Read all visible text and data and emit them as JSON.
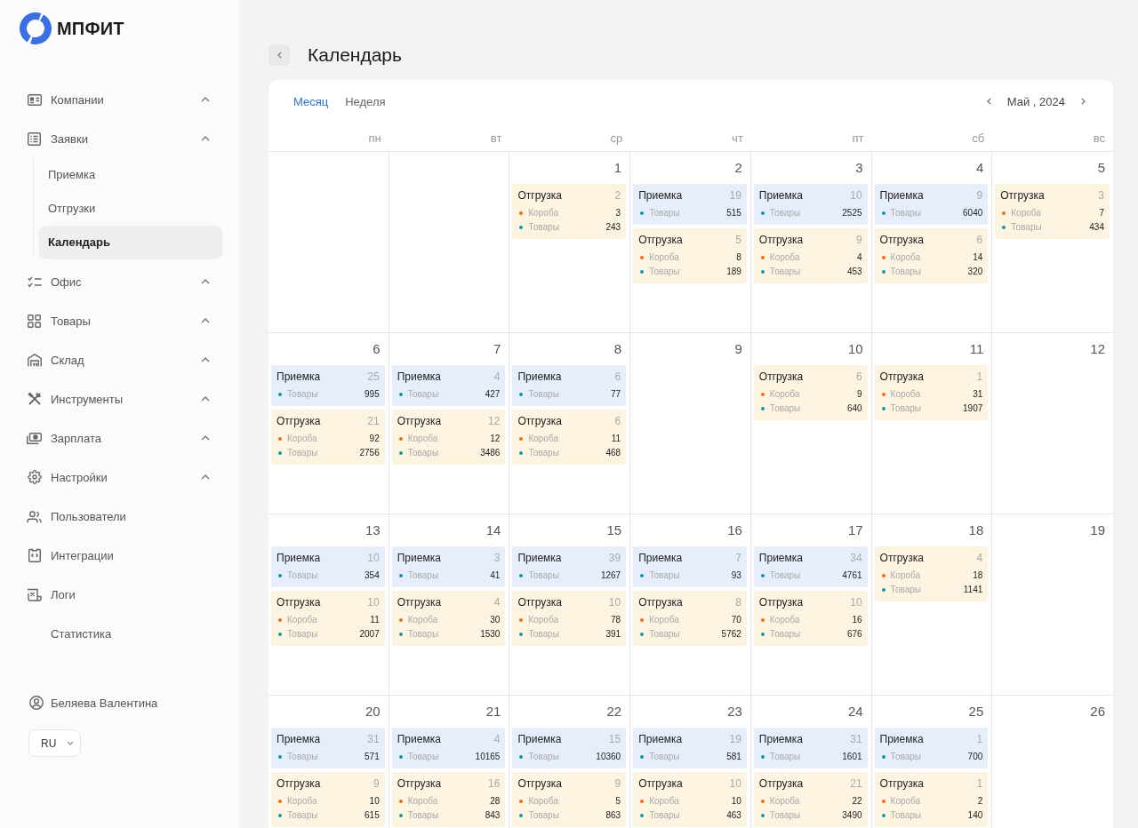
{
  "logo": {
    "text": "МПФИТ"
  },
  "sidebar": {
    "items": [
      {
        "label": "Компании",
        "kind": "group",
        "selected": false
      },
      {
        "label": "Заявки",
        "kind": "group",
        "selected": false,
        "children": [
          {
            "label": "Приемка",
            "selected": false
          },
          {
            "label": "Отгрузки",
            "selected": false
          },
          {
            "label": "Календарь",
            "selected": true
          }
        ]
      },
      {
        "label": "Офис",
        "kind": "group",
        "selected": false
      },
      {
        "label": "Товары",
        "kind": "group",
        "selected": false
      },
      {
        "label": "Склад",
        "kind": "group",
        "selected": false
      },
      {
        "label": "Инструменты",
        "kind": "group",
        "selected": false
      },
      {
        "label": "Зарплата",
        "kind": "group",
        "selected": false
      },
      {
        "label": "Настройки",
        "kind": "group",
        "selected": false
      },
      {
        "label": "Пользователи",
        "kind": "link",
        "selected": false
      },
      {
        "label": "Интеграции",
        "kind": "link",
        "selected": false
      },
      {
        "label": "Логи",
        "kind": "link",
        "selected": false
      },
      {
        "label": "Статистика",
        "kind": "link",
        "selected": false
      }
    ],
    "user": {
      "name": "Беляева Валентина"
    },
    "language": {
      "value": "RU"
    }
  },
  "calendar": {
    "title": "Календарь",
    "view_tabs": [
      {
        "label": "Месяц",
        "selected": true
      },
      {
        "label": "Неделя",
        "selected": false
      }
    ],
    "month_label": "Май , 2024",
    "weekdays": [
      "пн",
      "вт",
      "ср",
      "чт",
      "пт",
      "сб",
      "вс"
    ],
    "weeks": [
      [
        {
          "kind": "blank"
        },
        {
          "kind": "blank"
        },
        {
          "kind": "day",
          "day": "1",
          "events": [
            {
              "kind": "shipping",
              "title": "Отгрузка",
              "count": "2",
              "lines": [
                {
                  "label": "Короба",
                  "value": "3",
                  "color": "#f26b1d"
                },
                {
                  "label": "Товары",
                  "value": "243",
                  "color": "#1496a6"
                }
              ]
            }
          ]
        },
        {
          "kind": "day",
          "day": "2",
          "events": [
            {
              "kind": "receiving",
              "title": "Приемка",
              "count": "19",
              "lines": [
                {
                  "label": "Товары",
                  "value": "515",
                  "color": "#1496a6"
                }
              ]
            },
            {
              "kind": "shipping",
              "title": "Отгрузка",
              "count": "5",
              "lines": [
                {
                  "label": "Короба",
                  "value": "8",
                  "color": "#f26b1d"
                },
                {
                  "label": "Товары",
                  "value": "189",
                  "color": "#1496a6"
                }
              ]
            }
          ]
        },
        {
          "kind": "day",
          "day": "3",
          "events": [
            {
              "kind": "receiving",
              "title": "Приемка",
              "count": "10",
              "lines": [
                {
                  "label": "Товары",
                  "value": "2525",
                  "color": "#1496a6"
                }
              ]
            },
            {
              "kind": "shipping",
              "title": "Отгрузка",
              "count": "9",
              "lines": [
                {
                  "label": "Короба",
                  "value": "4",
                  "color": "#f26b1d"
                },
                {
                  "label": "Товары",
                  "value": "453",
                  "color": "#1496a6"
                }
              ]
            }
          ]
        },
        {
          "kind": "day",
          "day": "4",
          "events": [
            {
              "kind": "receiving",
              "title": "Приемка",
              "count": "9",
              "lines": [
                {
                  "label": "Товары",
                  "value": "6040",
                  "color": "#1496a6"
                }
              ]
            },
            {
              "kind": "shipping",
              "title": "Отгрузка",
              "count": "6",
              "lines": [
                {
                  "label": "Короба",
                  "value": "14",
                  "color": "#f26b1d"
                },
                {
                  "label": "Товары",
                  "value": "320",
                  "color": "#1496a6"
                }
              ]
            }
          ]
        },
        {
          "kind": "day",
          "day": "5",
          "events": [
            {
              "kind": "shipping",
              "title": "Отгрузка",
              "count": "3",
              "lines": [
                {
                  "label": "Короба",
                  "value": "7",
                  "color": "#f26b1d"
                },
                {
                  "label": "Товары",
                  "value": "434",
                  "color": "#1496a6"
                }
              ]
            }
          ]
        }
      ],
      [
        {
          "kind": "day",
          "day": "6",
          "events": [
            {
              "kind": "receiving",
              "title": "Приемка",
              "count": "25",
              "lines": [
                {
                  "label": "Товары",
                  "value": "995",
                  "color": "#1496a6"
                }
              ]
            },
            {
              "kind": "shipping",
              "title": "Отгрузка",
              "count": "21",
              "lines": [
                {
                  "label": "Короба",
                  "value": "92",
                  "color": "#f26b1d"
                },
                {
                  "label": "Товары",
                  "value": "2756",
                  "color": "#1496a6"
                }
              ]
            }
          ]
        },
        {
          "kind": "day",
          "day": "7",
          "events": [
            {
              "kind": "receiving",
              "title": "Приемка",
              "count": "4",
              "lines": [
                {
                  "label": "Товары",
                  "value": "427",
                  "color": "#1496a6"
                }
              ]
            },
            {
              "kind": "shipping",
              "title": "Отгрузка",
              "count": "12",
              "lines": [
                {
                  "label": "Короба",
                  "value": "12",
                  "color": "#f26b1d"
                },
                {
                  "label": "Товары",
                  "value": "3486",
                  "color": "#1496a6"
                }
              ]
            }
          ]
        },
        {
          "kind": "day",
          "day": "8",
          "events": [
            {
              "kind": "receiving",
              "title": "Приемка",
              "count": "6",
              "lines": [
                {
                  "label": "Товары",
                  "value": "77",
                  "color": "#1496a6"
                }
              ]
            },
            {
              "kind": "shipping",
              "title": "Отгрузка",
              "count": "6",
              "lines": [
                {
                  "label": "Короба",
                  "value": "11",
                  "color": "#f26b1d"
                },
                {
                  "label": "Товары",
                  "value": "468",
                  "color": "#1496a6"
                }
              ]
            }
          ]
        },
        {
          "kind": "day",
          "day": "9"
        },
        {
          "kind": "day",
          "day": "10",
          "events": [
            {
              "kind": "shipping",
              "title": "Отгрузка",
              "count": "6",
              "lines": [
                {
                  "label": "Короба",
                  "value": "9",
                  "color": "#f26b1d"
                },
                {
                  "label": "Товары",
                  "value": "640",
                  "color": "#1496a6"
                }
              ]
            }
          ]
        },
        {
          "kind": "day",
          "day": "11",
          "events": [
            {
              "kind": "shipping",
              "title": "Отгрузка",
              "count": "1",
              "lines": [
                {
                  "label": "Короба",
                  "value": "31",
                  "color": "#f26b1d"
                },
                {
                  "label": "Товары",
                  "value": "1907",
                  "color": "#1496a6"
                }
              ]
            }
          ]
        },
        {
          "kind": "day",
          "day": "12"
        }
      ],
      [
        {
          "kind": "day",
          "day": "13",
          "events": [
            {
              "kind": "receiving",
              "title": "Приемка",
              "count": "10",
              "lines": [
                {
                  "label": "Товары",
                  "value": "354",
                  "color": "#1496a6"
                }
              ]
            },
            {
              "kind": "shipping",
              "title": "Отгрузка",
              "count": "10",
              "lines": [
                {
                  "label": "Короба",
                  "value": "11",
                  "color": "#f26b1d"
                },
                {
                  "label": "Товары",
                  "value": "2007",
                  "color": "#1496a6"
                }
              ]
            }
          ]
        },
        {
          "kind": "day",
          "day": "14",
          "events": [
            {
              "kind": "receiving",
              "title": "Приемка",
              "count": "3",
              "lines": [
                {
                  "label": "Товары",
                  "value": "41",
                  "color": "#1496a6"
                }
              ]
            },
            {
              "kind": "shipping",
              "title": "Отгрузка",
              "count": "4",
              "lines": [
                {
                  "label": "Короба",
                  "value": "30",
                  "color": "#f26b1d"
                },
                {
                  "label": "Товары",
                  "value": "1530",
                  "color": "#1496a6"
                }
              ]
            }
          ]
        },
        {
          "kind": "day",
          "day": "15",
          "events": [
            {
              "kind": "receiving",
              "title": "Приемка",
              "count": "39",
              "lines": [
                {
                  "label": "Товары",
                  "value": "1267",
                  "color": "#1496a6"
                }
              ]
            },
            {
              "kind": "shipping",
              "title": "Отгрузка",
              "count": "10",
              "lines": [
                {
                  "label": "Короба",
                  "value": "78",
                  "color": "#f26b1d"
                },
                {
                  "label": "Товары",
                  "value": "391",
                  "color": "#1496a6"
                }
              ]
            }
          ]
        },
        {
          "kind": "day",
          "day": "16",
          "events": [
            {
              "kind": "receiving",
              "title": "Приемка",
              "count": "7",
              "lines": [
                {
                  "label": "Товары",
                  "value": "93",
                  "color": "#1496a6"
                }
              ]
            },
            {
              "kind": "shipping",
              "title": "Отгрузка",
              "count": "8",
              "lines": [
                {
                  "label": "Короба",
                  "value": "70",
                  "color": "#f26b1d"
                },
                {
                  "label": "Товары",
                  "value": "5762",
                  "color": "#1496a6"
                }
              ]
            }
          ]
        },
        {
          "kind": "day",
          "day": "17",
          "events": [
            {
              "kind": "receiving",
              "title": "Приемка",
              "count": "34",
              "lines": [
                {
                  "label": "Товары",
                  "value": "4761",
                  "color": "#1496a6"
                }
              ]
            },
            {
              "kind": "shipping",
              "title": "Отгрузка",
              "count": "10",
              "lines": [
                {
                  "label": "Короба",
                  "value": "16",
                  "color": "#f26b1d"
                },
                {
                  "label": "Товары",
                  "value": "676",
                  "color": "#1496a6"
                }
              ]
            }
          ]
        },
        {
          "kind": "day",
          "day": "18",
          "events": [
            {
              "kind": "shipping",
              "title": "Отгрузка",
              "count": "4",
              "lines": [
                {
                  "label": "Короба",
                  "value": "18",
                  "color": "#f26b1d"
                },
                {
                  "label": "Товары",
                  "value": "1141",
                  "color": "#1496a6"
                }
              ]
            }
          ]
        },
        {
          "kind": "day",
          "day": "19"
        }
      ],
      [
        {
          "kind": "day",
          "day": "20",
          "events": [
            {
              "kind": "receiving",
              "title": "Приемка",
              "count": "31",
              "lines": [
                {
                  "label": "Товары",
                  "value": "571",
                  "color": "#1496a6"
                }
              ]
            },
            {
              "kind": "shipping",
              "title": "Отгрузка",
              "count": "9",
              "lines": [
                {
                  "label": "Короба",
                  "value": "10",
                  "color": "#f26b1d"
                },
                {
                  "label": "Товары",
                  "value": "615",
                  "color": "#1496a6"
                }
              ]
            }
          ]
        },
        {
          "kind": "day",
          "day": "21",
          "events": [
            {
              "kind": "receiving",
              "title": "Приемка",
              "count": "4",
              "lines": [
                {
                  "label": "Товары",
                  "value": "10165",
                  "color": "#1496a6"
                }
              ]
            },
            {
              "kind": "shipping",
              "title": "Отгрузка",
              "count": "16",
              "lines": [
                {
                  "label": "Короба",
                  "value": "28",
                  "color": "#f26b1d"
                },
                {
                  "label": "Товары",
                  "value": "843",
                  "color": "#1496a6"
                }
              ]
            }
          ]
        },
        {
          "kind": "day",
          "day": "22",
          "events": [
            {
              "kind": "receiving",
              "title": "Приемка",
              "count": "15",
              "lines": [
                {
                  "label": "Товары",
                  "value": "10360",
                  "color": "#1496a6"
                }
              ]
            },
            {
              "kind": "shipping",
              "title": "Отгрузка",
              "count": "9",
              "lines": [
                {
                  "label": "Короба",
                  "value": "5",
                  "color": "#f26b1d"
                },
                {
                  "label": "Товары",
                  "value": "863",
                  "color": "#1496a6"
                }
              ]
            }
          ]
        },
        {
          "kind": "day",
          "day": "23",
          "events": [
            {
              "kind": "receiving",
              "title": "Приемка",
              "count": "19",
              "lines": [
                {
                  "label": "Товары",
                  "value": "581",
                  "color": "#1496a6"
                }
              ]
            },
            {
              "kind": "shipping",
              "title": "Отгрузка",
              "count": "10",
              "lines": [
                {
                  "label": "Короба",
                  "value": "10",
                  "color": "#f26b1d"
                },
                {
                  "label": "Товары",
                  "value": "463",
                  "color": "#1496a6"
                }
              ]
            }
          ]
        },
        {
          "kind": "day",
          "day": "24",
          "events": [
            {
              "kind": "receiving",
              "title": "Приемка",
              "count": "31",
              "lines": [
                {
                  "label": "Товары",
                  "value": "1601",
                  "color": "#1496a6"
                }
              ]
            },
            {
              "kind": "shipping",
              "title": "Отгрузка",
              "count": "21",
              "lines": [
                {
                  "label": "Короба",
                  "value": "22",
                  "color": "#f26b1d"
                },
                {
                  "label": "Товары",
                  "value": "3490",
                  "color": "#1496a6"
                }
              ]
            }
          ]
        },
        {
          "kind": "day",
          "day": "25",
          "events": [
            {
              "kind": "receiving",
              "title": "Приемка",
              "count": "1",
              "lines": [
                {
                  "label": "Товары",
                  "value": "700",
                  "color": "#1496a6"
                }
              ]
            },
            {
              "kind": "shipping",
              "title": "Отгрузка",
              "count": "1",
              "lines": [
                {
                  "label": "Короба",
                  "value": "2",
                  "color": "#f26b1d"
                },
                {
                  "label": "Товары",
                  "value": "140",
                  "color": "#1496a6"
                }
              ]
            }
          ]
        },
        {
          "kind": "day",
          "day": "26"
        }
      ]
    ]
  }
}
